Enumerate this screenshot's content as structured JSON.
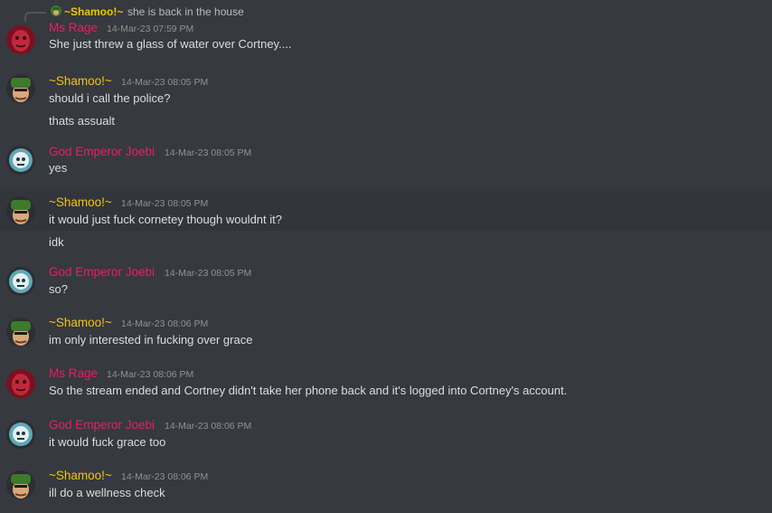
{
  "reply": {
    "author": "~Shamoo!~",
    "text": "she is back in the house",
    "avatar_icon": "soldier-avatar-icon"
  },
  "colors": {
    "background": "#36393f",
    "name_pink": "#e91e63",
    "name_gold": "#f1c40f",
    "timestamp": "#8e9297",
    "text": "#dcddde"
  },
  "messages": [
    {
      "author": "Ms Rage",
      "timestamp": "14-Mar-23 07:59 PM",
      "avatar": "red-face-avatar-icon",
      "lines": [
        "She just threw a glass of water over Cortney...."
      ]
    },
    {
      "author": "~Shamoo!~",
      "timestamp": "14-Mar-23 08:05 PM",
      "avatar": "soldier-avatar-icon",
      "lines": [
        "should i call the police?",
        "thats assualt"
      ]
    },
    {
      "author": "God Emperor Joebi",
      "timestamp": "14-Mar-23 08:05 PM",
      "avatar": "robot-head-avatar-icon",
      "lines": [
        "yes"
      ]
    },
    {
      "author": "~Shamoo!~",
      "timestamp": "14-Mar-23 08:05 PM",
      "avatar": "soldier-avatar-icon",
      "lines": [
        "it would just fuck cornetey though wouldnt it?",
        "idk"
      ]
    },
    {
      "author": "God Emperor Joebi",
      "timestamp": "14-Mar-23 08:05 PM",
      "avatar": "robot-head-avatar-icon",
      "lines": [
        "so?"
      ]
    },
    {
      "author": "~Shamoo!~",
      "timestamp": "14-Mar-23 08:06 PM",
      "avatar": "soldier-avatar-icon",
      "lines": [
        "im only interested in fucking over grace"
      ]
    },
    {
      "author": "Ms Rage",
      "timestamp": "14-Mar-23 08:06 PM",
      "avatar": "red-face-avatar-icon",
      "lines": [
        "So the stream ended and Cortney didn't take her phone back and it's logged into Cortney's account."
      ]
    },
    {
      "author": "God Emperor Joebi",
      "timestamp": "14-Mar-23 08:06 PM",
      "avatar": "robot-head-avatar-icon",
      "lines": [
        "it would fuck grace too"
      ]
    },
    {
      "author": "~Shamoo!~",
      "timestamp": "14-Mar-23 08:06 PM",
      "avatar": "soldier-avatar-icon",
      "lines": [
        "ill do a wellness check"
      ]
    }
  ]
}
